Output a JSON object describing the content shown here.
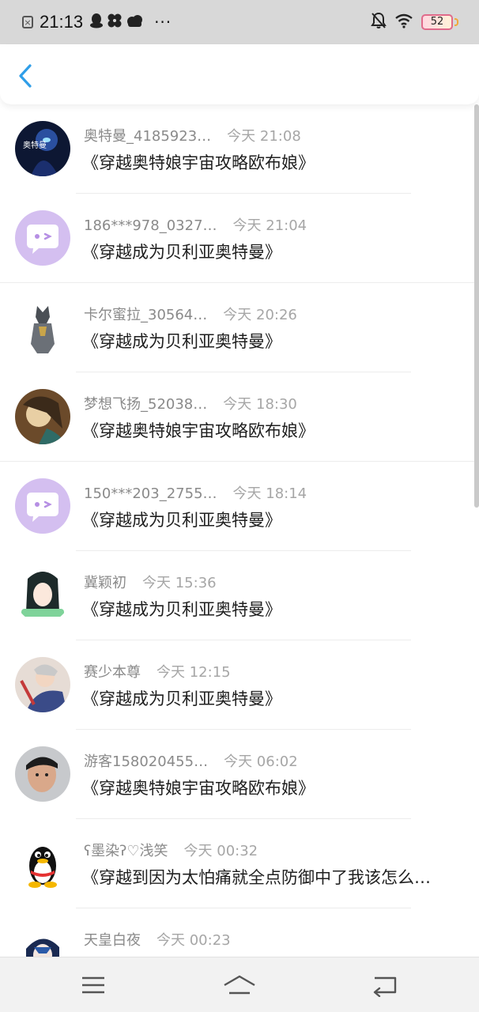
{
  "status_bar": {
    "time": "21:13",
    "battery": "52",
    "more": "···"
  },
  "header": {
    "back_icon": "chevron-left-icon",
    "accent": "#2f9ee8"
  },
  "list": {
    "items": [
      {
        "name": "奥特曼_4185923…",
        "time": "今天 21:08",
        "title": "《穿越奥特娘宇宙攻略欧布娘》"
      },
      {
        "name": "186***978_0327…",
        "time": "今天 21:04",
        "title": "《穿越成为贝利亚奥特曼》"
      },
      {
        "name": "卡尔蜜拉_30564…",
        "time": "今天 20:26",
        "title": "《穿越成为贝利亚奥特曼》"
      },
      {
        "name": "梦想飞扬_52038…",
        "time": "今天 18:30",
        "title": "《穿越奥特娘宇宙攻略欧布娘》"
      },
      {
        "name": "150***203_2755…",
        "time": "今天 18:14",
        "title": "《穿越成为贝利亚奥特曼》"
      },
      {
        "name": "冀颖初",
        "time": "今天 15:36",
        "title": "《穿越成为贝利亚奥特曼》"
      },
      {
        "name": "赛少本尊",
        "time": "今天 12:15",
        "title": "《穿越成为贝利亚奥特曼》"
      },
      {
        "name": "游客158020455…",
        "time": "今天 06:02",
        "title": "《穿越奥特娘宇宙攻略欧布娘》"
      },
      {
        "name": "ʕ墨染ʔ♡浅笑",
        "time": "今天 00:32",
        "title": "《穿越到因为太怕痛就全点防御中了我该怎么…"
      },
      {
        "name": "天皇白夜",
        "time": "今天 00:23",
        "title": ""
      }
    ]
  },
  "navbar": {
    "menu_icon": "menu-icon",
    "home_icon": "home-icon",
    "back_icon": "back-icon"
  }
}
